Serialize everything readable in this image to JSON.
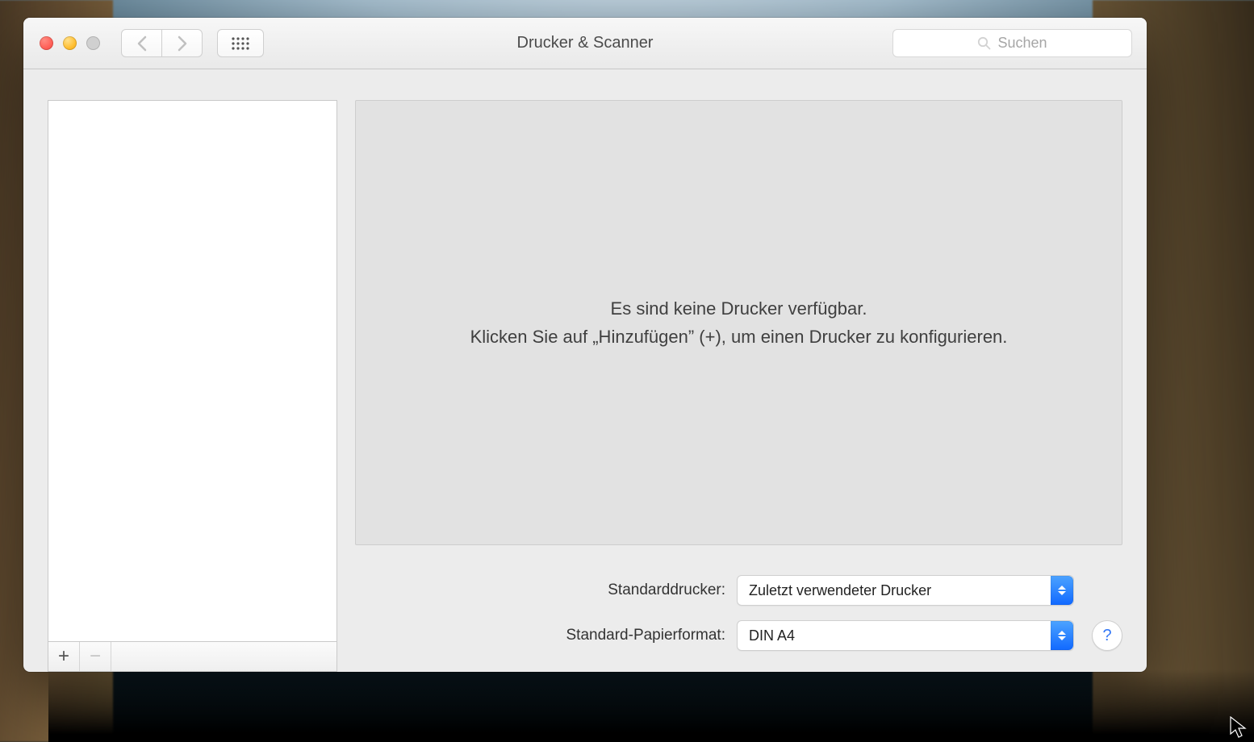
{
  "window": {
    "title": "Drucker & Scanner"
  },
  "search": {
    "placeholder": "Suchen"
  },
  "detail": {
    "empty_line1": "Es sind keine Drucker verfügbar.",
    "empty_line2": "Klicken Sie auf „Hinzufügen” (+), um einen Drucker zu konfigurieren."
  },
  "form": {
    "default_printer_label": "Standarddrucker:",
    "default_printer_value": "Zuletzt verwendeter Drucker",
    "paper_size_label": "Standard-Papierformat:",
    "paper_size_value": "DIN A4"
  },
  "footer": {
    "add": "+",
    "remove": "−"
  },
  "help": {
    "glyph": "?"
  }
}
